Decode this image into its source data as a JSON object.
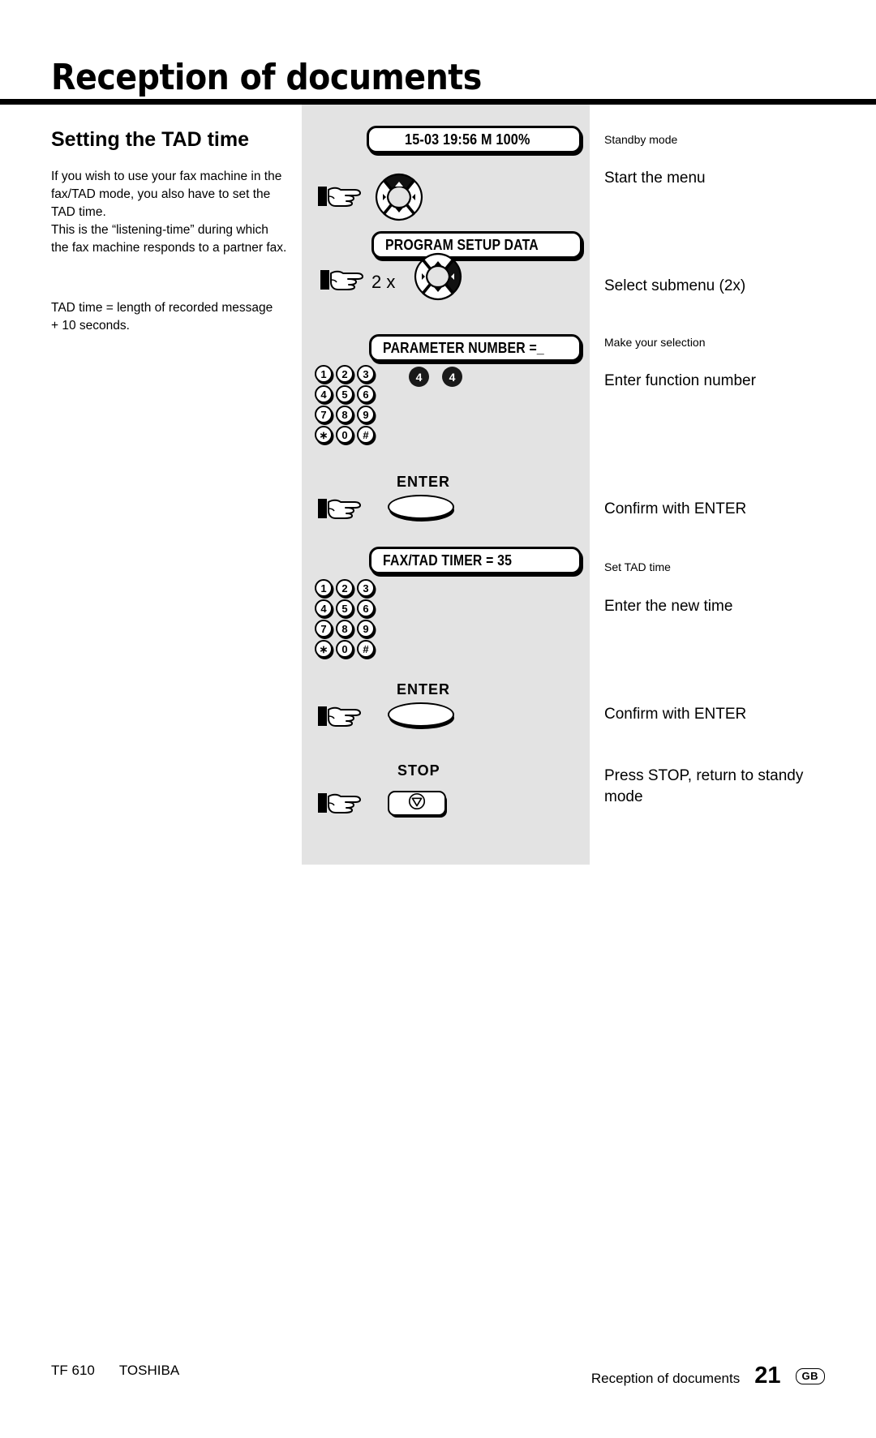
{
  "header": {
    "chapter_title": "Reception of documents"
  },
  "left_column": {
    "section_title": "Setting the TAD time",
    "paragraph_1": "If you wish to use your fax machine in the fax/TAD mode, you also have to set the TAD time.\nThis is the “listening-time” during which the fax machine responds to a partner fax.",
    "paragraph_2": "TAD time =  length of recorded message\n+  10 seconds."
  },
  "steps": [
    {
      "id": "standby",
      "display": "15-03 19:56  M 100%",
      "annotation": "Standby mode",
      "annotation_style": "small"
    },
    {
      "id": "start-menu",
      "annotation": "Start the menu",
      "annotation_style": "big",
      "control": "navpad",
      "highlight": "up"
    },
    {
      "id": "program-setup",
      "display": "PROGRAM SETUP DATA"
    },
    {
      "id": "select-submenu",
      "annotation": "Select submenu (2x)",
      "annotation_style": "big",
      "control": "navpad",
      "highlight": "right",
      "multiplier": "2 x"
    },
    {
      "id": "parameter-number",
      "display": "PARAMETER NUMBER =_",
      "annotation": "Make your selection",
      "annotation_style": "small"
    },
    {
      "id": "enter-function-number",
      "annotation": "Enter function number",
      "annotation_style": "big",
      "control": "keypad",
      "pressed_keys": [
        "4",
        "4"
      ]
    },
    {
      "id": "confirm-enter-1",
      "annotation": "Confirm with ENTER",
      "annotation_style": "big",
      "control": "enter",
      "button_label": "ENTER"
    },
    {
      "id": "fax-tad-timer",
      "display": "FAX/TAD TIMER    =  35",
      "annotation": "Set TAD time",
      "annotation_style": "small"
    },
    {
      "id": "enter-new-time",
      "annotation": "Enter the new time",
      "annotation_style": "big",
      "control": "keypad"
    },
    {
      "id": "confirm-enter-2",
      "annotation": "Confirm with ENTER",
      "annotation_style": "big",
      "control": "enter",
      "button_label": "ENTER"
    },
    {
      "id": "press-stop",
      "annotation": "Press STOP, return to standy mode",
      "annotation_style": "big",
      "control": "stop",
      "button_label": "STOP"
    }
  ],
  "keypad": {
    "rows": [
      [
        "1",
        "2",
        "3"
      ],
      [
        "4",
        "5",
        "6"
      ],
      [
        "7",
        "8",
        "9"
      ],
      [
        "∗",
        "0",
        "#"
      ]
    ]
  },
  "footer": {
    "model": "TF 610",
    "brand": "TOSHIBA",
    "chapter": "Reception of documents",
    "page_number": "21",
    "region_code": "GB"
  },
  "colors": {
    "panel_grey": "#e3e3e3",
    "ink": "#000000",
    "key_black": "#1a1a1a"
  }
}
